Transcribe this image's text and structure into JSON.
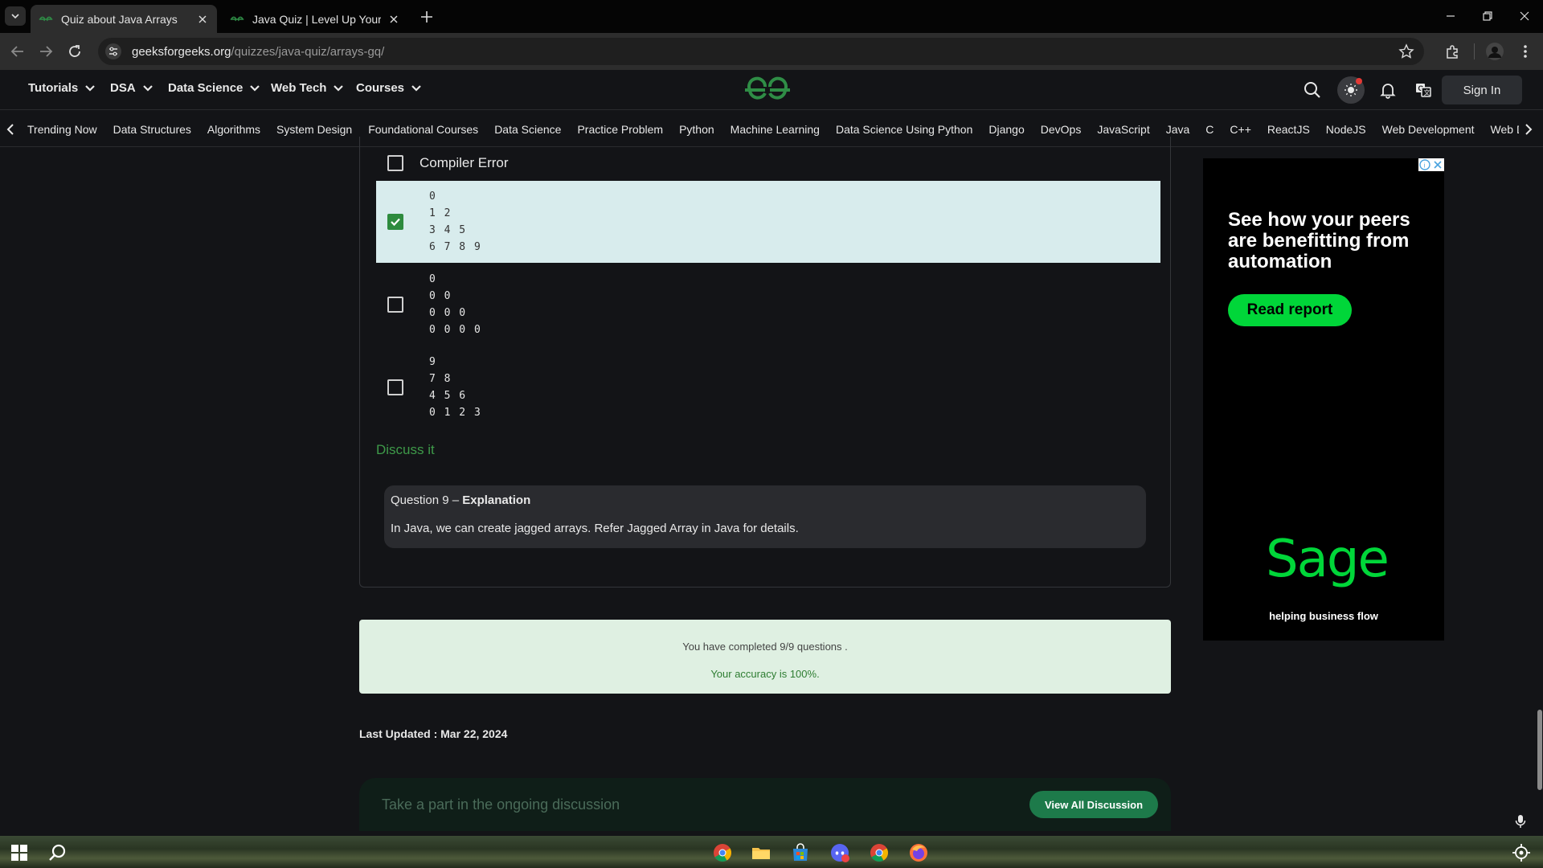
{
  "browser": {
    "tabs": [
      {
        "title": "Quiz about Java Arrays",
        "active": true
      },
      {
        "title": "Java Quiz | Level Up Your Java S",
        "active": false
      }
    ],
    "url_host": "geeksforgeeks.org",
    "url_path": "/quizzes/java-quiz/arrays-gq/"
  },
  "site": {
    "menu": [
      "Tutorials",
      "DSA",
      "Data Science",
      "Web Tech",
      "Courses"
    ],
    "sign_in": "Sign In",
    "topics": [
      "Trending Now",
      "Data Structures",
      "Algorithms",
      "System Design",
      "Foundational Courses",
      "Data Science",
      "Practice Problem",
      "Python",
      "Machine Learning",
      "Data Science Using Python",
      "Django",
      "DevOps",
      "JavaScript",
      "Java",
      "C",
      "C++",
      "ReactJS",
      "NodeJS",
      "Web Development",
      "Web Design",
      "W"
    ],
    "accent": "#2f8d46"
  },
  "quiz": {
    "options": [
      {
        "text": "Compiler Error",
        "checked": false
      },
      {
        "code": "0\n1 2\n3 4 5\n6 7 8 9",
        "checked": true
      },
      {
        "code": "0\n0 0\n0 0 0\n0 0 0 0",
        "checked": false
      },
      {
        "code": "9\n7 8\n4 5 6\n0 1 2 3",
        "checked": false
      }
    ],
    "discuss_link": "Discuss it",
    "explanation": {
      "question_prefix": "Question 9 – ",
      "title": "Explanation",
      "body": "In Java, we can create jagged arrays.  Refer Jagged Array in Java for details."
    },
    "result": {
      "completed": "You have completed 9/9 questions .",
      "accuracy": "Your accuracy is 100%."
    },
    "last_updated_label": "Last Updated :",
    "last_updated_date": "Mar 22, 2024",
    "discussion_placeholder": "Take a part in the ongoing discussion",
    "view_all": "View All Discussion"
  },
  "ad": {
    "headline": "See how your peers are benefitting from automation",
    "cta": "Read report",
    "brand": "Sage",
    "tagline": "helping business flow"
  }
}
